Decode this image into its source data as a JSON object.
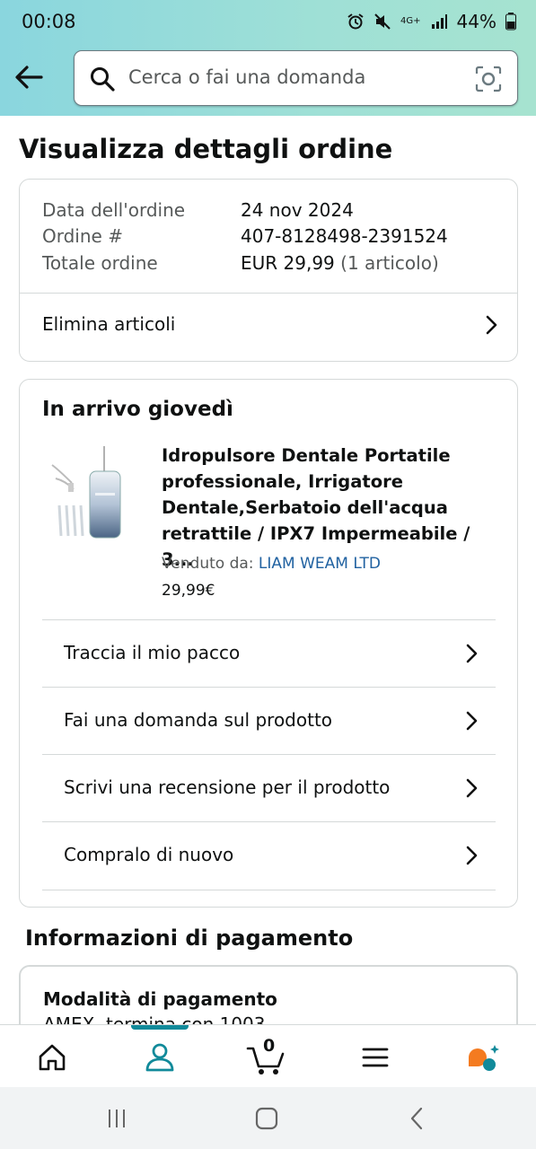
{
  "status": {
    "time": "00:08",
    "battery": "44%",
    "network": "4G+"
  },
  "search": {
    "placeholder": "Cerca o fai una domanda"
  },
  "page": {
    "title": "Visualizza dettagli ordine"
  },
  "order": {
    "date_label": "Data dell'ordine",
    "date_value": "24 nov 2024",
    "number_label": "Ordine #",
    "number_value": "407-8128498-2391524",
    "total_label": "Totale ordine",
    "total_value": "EUR 29,99",
    "total_count": "(1 articolo)",
    "delete_items": "Elimina articoli"
  },
  "shipment": {
    "heading": "In arrivo giovedì",
    "product_title": "Idropulsore Dentale Portatile professionale, Irrigatore Dentale,Serbatoio dell'acqua retrattile / IPX7 Impermeabile / 3...",
    "sold_by_label": "Venduto da:",
    "seller": "LIAM WEAM LTD",
    "price": "29,99€",
    "actions": [
      "Traccia il mio pacco",
      "Fai una domanda sul prodotto",
      "Scrivi una recensione per il prodotto",
      "Compralo di nuovo"
    ]
  },
  "payment": {
    "heading": "Informazioni di pagamento",
    "method_label": "Modalità di pagamento",
    "method_value": "AMEX, termina con 1003"
  },
  "nav": {
    "cart_count": "0"
  },
  "colors": {
    "accent": "#118a9a",
    "link": "#2162a1",
    "header": "#8ad6de"
  }
}
